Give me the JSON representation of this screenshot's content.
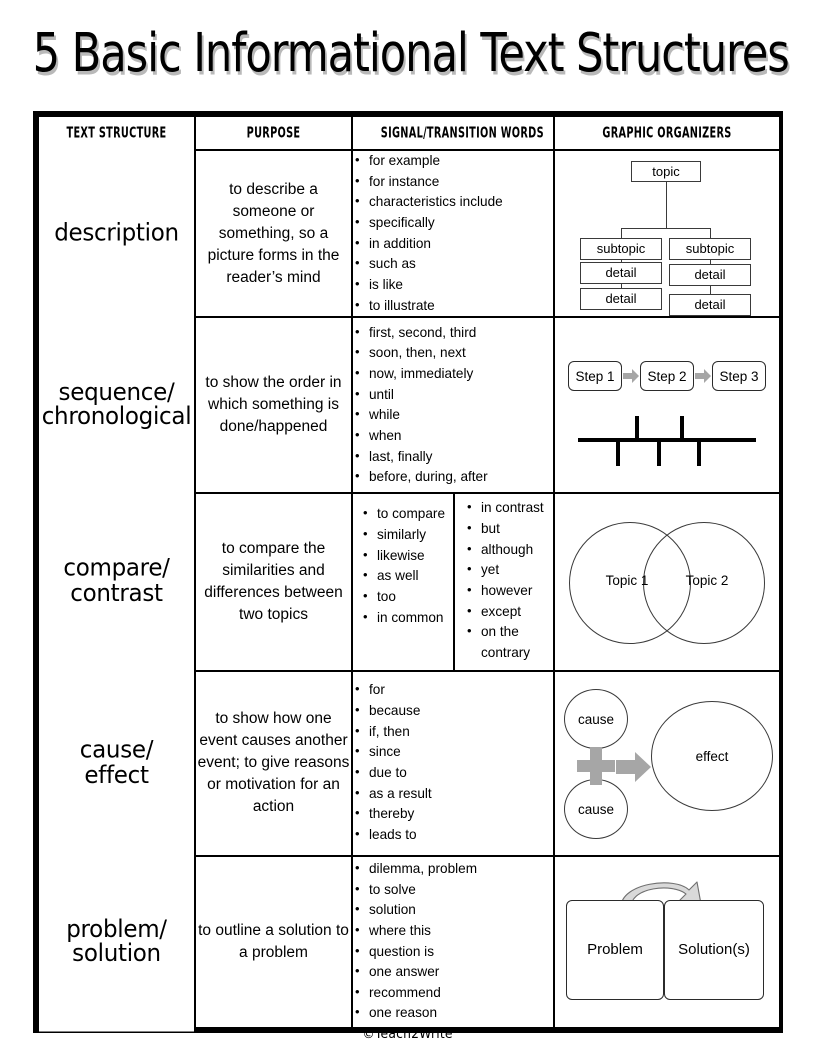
{
  "title": "5 Basic Informational Text Structures",
  "footer": "©Teach2Write",
  "headers": {
    "text_structure": "TEXT STRUCTURE",
    "purpose": "PURPOSE",
    "signal_words": "SIGNAL/TRANSITION  WORDS",
    "graphic_organizers": "GRAPHIC ORGANIZERS"
  },
  "rows": [
    {
      "structure": "description",
      "purpose": "to describe a someone or something, so a picture forms in the reader’s mind",
      "signal_words": [
        "for example",
        "for instance",
        "characteristics  include",
        " specifically",
        "in addition",
        "such as",
        "is like",
        "to illustrate"
      ],
      "organizer": {
        "type": "hierarchy-tree",
        "topic": "topic",
        "subtopic_left": "subtopic",
        "subtopic_right": "subtopic",
        "detail_left_1": "detail",
        "detail_left_2": "detail",
        "detail_right_1": "detail",
        "detail_right_2": "detail"
      }
    },
    {
      "structure": "sequence/ chronological",
      "structure_lines": [
        "sequence/",
        "chronological"
      ],
      "purpose": "to show the order in which something is done/happened",
      "signal_words": [
        "first, second,  third",
        "soon,  then,  next",
        "now,  immediately",
        "until",
        "while",
        " when",
        "last, finally",
        "before,  during,  after"
      ],
      "organizer": {
        "type": "step-flow-timeline",
        "step1": "Step 1",
        "step2": "Step 2",
        "step3": "Step 3"
      }
    },
    {
      "structure": "compare/ contrast",
      "structure_lines": [
        "compare/",
        "contrast"
      ],
      "purpose": "to compare the similarities  and differences between two topics",
      "signal_words_left": [
        "to compare",
        "similarly",
        "likewise",
        "as well",
        "too",
        "in common"
      ],
      "signal_words_right": [
        "in contrast",
        "but",
        "although",
        "yet",
        "however",
        "except",
        "on the contrary"
      ],
      "organizer": {
        "type": "venn-diagram",
        "topic1": "Topic 1",
        "topic2": "Topic 2"
      }
    },
    {
      "structure": "cause/ effect",
      "structure_lines": [
        "cause/",
        "effect"
      ],
      "purpose": "to show how one event causes another event; to give reasons or motivation  for an action",
      "signal_words": [
        "for",
        "because",
        "if, then",
        "since",
        " due to",
        "as a result",
        "thereby",
        "leads to"
      ],
      "organizer": {
        "type": "cause-effect",
        "cause1": "cause",
        "cause2": "cause",
        "effect": "effect"
      }
    },
    {
      "structure": "problem/ solution",
      "structure_lines": [
        "problem/",
        "solution"
      ],
      "purpose": "to outline  a solution  to a problem",
      "signal_words": [
        "dilemma,  problem",
        "to solve",
        "solution",
        "where this",
        "question  is",
        "one answer",
        "recommend",
        "one reason"
      ],
      "organizer": {
        "type": "problem-solution",
        "problem": "Problem",
        "solution": "Solution(s)"
      }
    }
  ],
  "colors": {
    "ink": "#000000",
    "diagram_stroke": "#3a3a3a",
    "arrow_gray": "#a6a6a6",
    "title_shadow": "#b9b9b9"
  }
}
